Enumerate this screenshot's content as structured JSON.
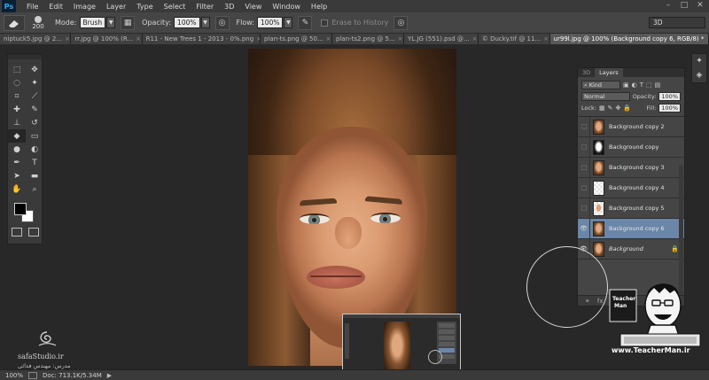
{
  "app": {
    "logo": "Ps"
  },
  "menu": [
    "File",
    "Edit",
    "Image",
    "Layer",
    "Type",
    "Select",
    "Filter",
    "3D",
    "View",
    "Window",
    "Help"
  ],
  "window_controls": [
    "–",
    "□",
    "✕"
  ],
  "options": {
    "brush_size": "200",
    "mode_label": "Mode:",
    "mode_value": "Brush",
    "opacity_label": "Opacity:",
    "opacity_value": "100%",
    "flow_label": "Flow:",
    "flow_value": "100%",
    "erase_history": "Erase to History",
    "workspace": "3D"
  },
  "tabs": [
    {
      "label": "niptuck5.jpg @ 2...",
      "active": false
    },
    {
      "label": "rr.jpg @ 100% (R...",
      "active": false
    },
    {
      "label": "R11 - New Trees 1 - 2013 - 0%.png",
      "active": false
    },
    {
      "label": "plan-ts.png @ 50...",
      "active": false
    },
    {
      "label": "plan-ts2.png @ 5...",
      "active": false
    },
    {
      "label": "YL.JG (551).psd @...",
      "active": false
    },
    {
      "label": "© Ducky.tif @ 11...",
      "active": false
    },
    {
      "label": "ur99l.jpg @ 100% (Background copy 6, RGB/8) *",
      "active": true
    }
  ],
  "layers_panel": {
    "tabs": [
      "3D",
      "Layers"
    ],
    "filter": "Kind",
    "blend_mode": "Normal",
    "opacity_label": "Opacity:",
    "opacity_value": "100%",
    "lock_label": "Lock:",
    "fill_label": "Fill:",
    "fill_value": "100%",
    "layers": [
      {
        "name": "Background copy 2",
        "visible": false,
        "selected": false,
        "thumb": "color"
      },
      {
        "name": "Background copy",
        "visible": false,
        "selected": false,
        "thumb": "bw"
      },
      {
        "name": "Background copy 3",
        "visible": false,
        "selected": false,
        "thumb": "color"
      },
      {
        "name": "Background copy 4",
        "visible": false,
        "selected": false,
        "thumb": "checker"
      },
      {
        "name": "Background copy 5",
        "visible": false,
        "selected": false,
        "thumb": "checker2"
      },
      {
        "name": "Background copy 6",
        "visible": true,
        "selected": true,
        "thumb": "color"
      },
      {
        "name": "Background",
        "visible": true,
        "selected": false,
        "thumb": "color",
        "locked": true
      }
    ]
  },
  "status": {
    "zoom": "100%",
    "doc": "Doc: 713.1K/5.34M"
  },
  "watermarks": {
    "safa_name": "safaStudio.ir",
    "safa_sub": "مدرس: مهندس فدائی",
    "teacher_url": "www.TeacherMan.ir"
  },
  "colors": {
    "accent": "#6a86a8",
    "panel": "#454545",
    "bg": "#282828"
  }
}
